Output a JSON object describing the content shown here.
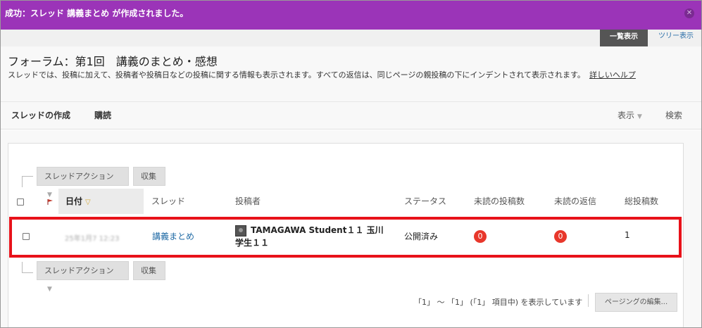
{
  "banner": {
    "message": "成功：スレッド 講義まとめ が作成されました。",
    "close_icon": "close-icon"
  },
  "view_tabs": {
    "active": "一覧表示",
    "other": "ツリー表示"
  },
  "header": {
    "title": "フォーラム：第1回　講義のまとめ・感想",
    "description": "スレッドでは、投稿に加えて、投稿者や投稿日などの投稿に関する情報も表示されます。すべての返信は、同じページの親投稿の下にインデントされて表示されます。",
    "help_link": "詳しいヘルプ"
  },
  "action_bar": {
    "create_thread": "スレッドの作成",
    "subscribe": "購読",
    "display": "表示",
    "search": "検索"
  },
  "toolbar": {
    "thread_actions": "スレッドアクション",
    "collect": "収集"
  },
  "table": {
    "columns": {
      "date": "日付",
      "thread": "スレッド",
      "author": "投稿者",
      "status": "ステータス",
      "unread_posts": "未読の投稿数",
      "unread_replies": "未読の返信",
      "total_posts": "総投稿数"
    },
    "rows": [
      {
        "date": "25年1月7 12:23",
        "thread": "講義まとめ",
        "author": "TAMAGAWA Student１１ 玉川学生１１",
        "status": "公開済み",
        "unread_posts": "0",
        "unread_replies": "0",
        "total_posts": "1"
      }
    ]
  },
  "paging": {
    "summary": "「1」 ～ 「1」 (「1」 項目中) を表示しています",
    "edit_button": "ページングの編集..."
  },
  "colors": {
    "banner": "#9b34b8",
    "highlight": "#e8121a",
    "badge": "#e8372b",
    "link": "#1f6aa5"
  }
}
